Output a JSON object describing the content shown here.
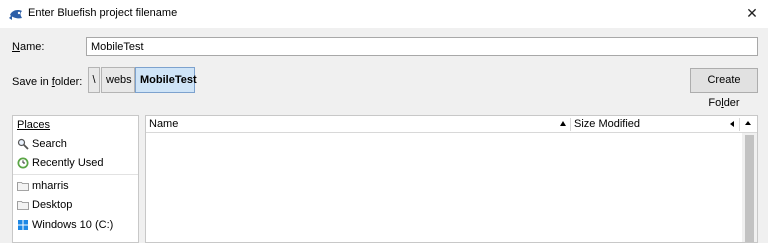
{
  "window": {
    "title": "Enter Bluefish project filename",
    "close_glyph": "✕"
  },
  "name_field": {
    "label_u": "N",
    "label_rest": "ame:",
    "value": "MobileTest"
  },
  "save_in": {
    "label_pre": "Save in ",
    "label_u": "f",
    "label_post": "older:",
    "path": [
      {
        "label": "\\"
      },
      {
        "label": "webs"
      },
      {
        "label": "MobileTest"
      }
    ]
  },
  "create_folder": {
    "label_pre": "Create Fo",
    "label_u": "l",
    "label_post": "der"
  },
  "places": {
    "header": "Places",
    "items": [
      {
        "label": "Search",
        "icon": "search-icon"
      },
      {
        "label": "Recently Used",
        "icon": "recently-used-icon"
      },
      {
        "label": "mharris",
        "icon": "folder-icon"
      },
      {
        "label": "Desktop",
        "icon": "folder-icon"
      },
      {
        "label": "Windows 10 (C:)",
        "icon": "drive-icon"
      }
    ]
  },
  "file_list": {
    "columns": {
      "name": "Name",
      "size": "Size",
      "modified": "Modified"
    }
  },
  "colors": {
    "dialog_bg": "#f0f0f0",
    "active_crumb_bg": "#cfe4f7",
    "active_crumb_border": "#7da2ce"
  }
}
